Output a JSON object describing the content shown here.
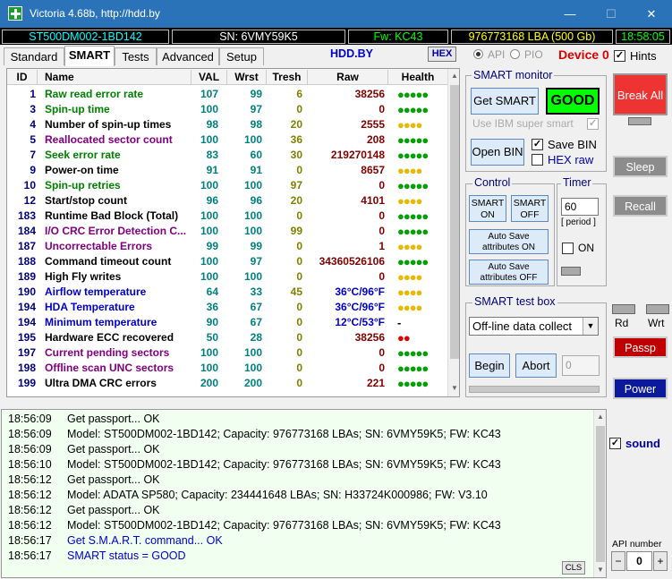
{
  "window": {
    "title": "Victoria 4.68b, http://hdd.by"
  },
  "titlebar_controls": {
    "minimize": "—",
    "maximize": "☐",
    "close": "✕"
  },
  "drive": {
    "model": "ST500DM002-1BD142",
    "serial": "SN: 6VMY59K5",
    "firmware": "Fw: KC43",
    "lba": "976773168 LBA (500 Gb)",
    "clock": "18:58:05"
  },
  "tabs": [
    {
      "label": "Standard"
    },
    {
      "label": "SMART"
    },
    {
      "label": "Tests"
    },
    {
      "label": "Advanced"
    },
    {
      "label": "Setup"
    }
  ],
  "header": {
    "site": "HDD.BY",
    "hex_label": "HEX",
    "api_label": "API",
    "pio_label": "PIO",
    "device": "Device 0",
    "hints_label": "Hints"
  },
  "table": {
    "columns": [
      "ID",
      "Name",
      "VAL",
      "Wrst",
      "Tresh",
      "Raw",
      "Health"
    ],
    "rows": [
      {
        "id": "1",
        "name": "Raw read error rate",
        "val": "107",
        "wrst": "99",
        "thr": "6",
        "raw": "38256",
        "health": "●●●●●",
        "name_color": "#008000",
        "health_color": "#00a000"
      },
      {
        "id": "3",
        "name": "Spin-up time",
        "val": "100",
        "wrst": "97",
        "thr": "0",
        "raw": "0",
        "health": "●●●●●",
        "name_color": "#008000",
        "health_color": "#00a000"
      },
      {
        "id": "4",
        "name": "Number of spin-up times",
        "val": "98",
        "wrst": "98",
        "thr": "20",
        "raw": "2555",
        "health": "●●●●",
        "name_color": "#000000",
        "health_color": "#e8b800"
      },
      {
        "id": "5",
        "name": "Reallocated sector count",
        "val": "100",
        "wrst": "100",
        "thr": "36",
        "raw": "208",
        "health": "●●●●●",
        "name_color": "#800080",
        "health_color": "#00a000"
      },
      {
        "id": "7",
        "name": "Seek error rate",
        "val": "83",
        "wrst": "60",
        "thr": "30",
        "raw": "219270148",
        "health": "●●●●●",
        "name_color": "#008000",
        "health_color": "#00a000"
      },
      {
        "id": "9",
        "name": "Power-on time",
        "val": "91",
        "wrst": "91",
        "thr": "0",
        "raw": "8657",
        "health": "●●●●",
        "name_color": "#000000",
        "health_color": "#e8b800"
      },
      {
        "id": "10",
        "name": "Spin-up retries",
        "val": "100",
        "wrst": "100",
        "thr": "97",
        "raw": "0",
        "health": "●●●●●",
        "name_color": "#008000",
        "health_color": "#00a000"
      },
      {
        "id": "12",
        "name": "Start/stop count",
        "val": "96",
        "wrst": "96",
        "thr": "20",
        "raw": "4101",
        "health": "●●●●",
        "name_color": "#000000",
        "health_color": "#e8b800"
      },
      {
        "id": "183",
        "name": "Runtime Bad Block (Total)",
        "val": "100",
        "wrst": "100",
        "thr": "0",
        "raw": "0",
        "health": "●●●●●",
        "name_color": "#000000",
        "health_color": "#00a000"
      },
      {
        "id": "184",
        "name": "I/O CRC Error Detection C...",
        "val": "100",
        "wrst": "100",
        "thr": "99",
        "raw": "0",
        "health": "●●●●●",
        "name_color": "#800080",
        "health_color": "#00a000"
      },
      {
        "id": "187",
        "name": "Uncorrectable Errors",
        "val": "99",
        "wrst": "99",
        "thr": "0",
        "raw": "1",
        "health": "●●●●",
        "name_color": "#800080",
        "health_color": "#e8b800"
      },
      {
        "id": "188",
        "name": "Command timeout count",
        "val": "100",
        "wrst": "97",
        "thr": "0",
        "raw": "34360526106",
        "health": "●●●●●",
        "name_color": "#000000",
        "health_color": "#00a000"
      },
      {
        "id": "189",
        "name": "High Fly writes",
        "val": "100",
        "wrst": "100",
        "thr": "0",
        "raw": "0",
        "health": "●●●●",
        "name_color": "#000000",
        "health_color": "#e8b800"
      },
      {
        "id": "190",
        "name": "Airflow temperature",
        "val": "64",
        "wrst": "33",
        "thr": "45",
        "raw": "36°C/96°F",
        "health": "●●●●",
        "name_color": "#0000cc",
        "health_color": "#e8b800",
        "raw_color": "#0000cc"
      },
      {
        "id": "194",
        "name": "HDA Temperature",
        "val": "36",
        "wrst": "67",
        "thr": "0",
        "raw": "36°C/96°F",
        "health": "●●●●",
        "name_color": "#0000cc",
        "health_color": "#e8b800",
        "raw_color": "#0000cc"
      },
      {
        "id": "194",
        "name": "Minimum temperature",
        "val": "90",
        "wrst": "67",
        "thr": "0",
        "raw": "12°C/53°F",
        "health": "-",
        "name_color": "#0000cc",
        "health_color": "#000000",
        "raw_color": "#0000cc"
      },
      {
        "id": "195",
        "name": "Hardware ECC recovered",
        "val": "50",
        "wrst": "28",
        "thr": "0",
        "raw": "38256",
        "health": "●●",
        "name_color": "#000000",
        "health_color": "#e00000"
      },
      {
        "id": "197",
        "name": "Current pending sectors",
        "val": "100",
        "wrst": "100",
        "thr": "0",
        "raw": "0",
        "health": "●●●●●",
        "name_color": "#800080",
        "health_color": "#00a000"
      },
      {
        "id": "198",
        "name": "Offline scan UNC sectors",
        "val": "100",
        "wrst": "100",
        "thr": "0",
        "raw": "0",
        "health": "●●●●●",
        "name_color": "#800080",
        "health_color": "#00a000"
      },
      {
        "id": "199",
        "name": "Ultra DMA CRC errors",
        "val": "200",
        "wrst": "200",
        "thr": "0",
        "raw": "221",
        "health": "●●●●●",
        "name_color": "#000000",
        "health_color": "#00a000"
      }
    ]
  },
  "smart_monitor": {
    "title": "SMART monitor",
    "get_smart": "Get SMART",
    "status": "GOOD",
    "ibm_label": "Use IBM super smart",
    "open_bin": "Open BIN",
    "save_bin": "Save BIN",
    "hex_raw": "HEX raw"
  },
  "control": {
    "title": "Control",
    "smart_on": "SMART ON",
    "smart_off": "SMART OFF",
    "autosave_on": "Auto Save attributes ON",
    "autosave_off": "Auto Save attributes OFF"
  },
  "timer": {
    "title": "Timer",
    "value": "60",
    "period_label": "[ period ]",
    "on_label": "ON"
  },
  "smart_test": {
    "title": "SMART test box",
    "selected": "Off-line data collect",
    "begin": "Begin",
    "abort": "Abort",
    "value": "0"
  },
  "log": {
    "lines": [
      {
        "time": "18:56:09",
        "text": "Get passport... OK",
        "color": "#000000"
      },
      {
        "time": "18:56:09",
        "text": "Model: ST500DM002-1BD142; Capacity: 976773168 LBAs; SN: 6VMY59K5; FW: KC43",
        "color": "#000000"
      },
      {
        "time": "18:56:09",
        "text": "Get passport... OK",
        "color": "#000000"
      },
      {
        "time": "18:56:10",
        "text": "Model: ST500DM002-1BD142; Capacity: 976773168 LBAs; SN: 6VMY59K5; FW: KC43",
        "color": "#000000"
      },
      {
        "time": "18:56:12",
        "text": "Get passport... OK",
        "color": "#000000"
      },
      {
        "time": "18:56:12",
        "text": "Model: ADATA SP580; Capacity: 234441648 LBAs; SN: H33724K000986; FW: V3.10",
        "color": "#000000"
      },
      {
        "time": "18:56:12",
        "text": "Get passport... OK",
        "color": "#000000"
      },
      {
        "time": "18:56:12",
        "text": "Model: ST500DM002-1BD142; Capacity: 976773168 LBAs; SN: 6VMY59K5; FW: KC43",
        "color": "#000000"
      },
      {
        "time": "18:56:17",
        "text": "Get S.M.A.R.T. command... OK",
        "color": "#0000cc"
      },
      {
        "time": "18:56:17",
        "text": "SMART status = GOOD",
        "color": "#0000cc"
      }
    ],
    "cls_label": "CLS"
  },
  "right_panel": {
    "break_all": "Break All",
    "sleep": "Sleep",
    "recall": "Recall",
    "rd": "Rd",
    "wrt": "Wrt",
    "passp": "Passp",
    "power": "Power",
    "sound": "sound",
    "api_number_label": "API number",
    "api_number": "0",
    "minus": "−",
    "plus": "+"
  }
}
